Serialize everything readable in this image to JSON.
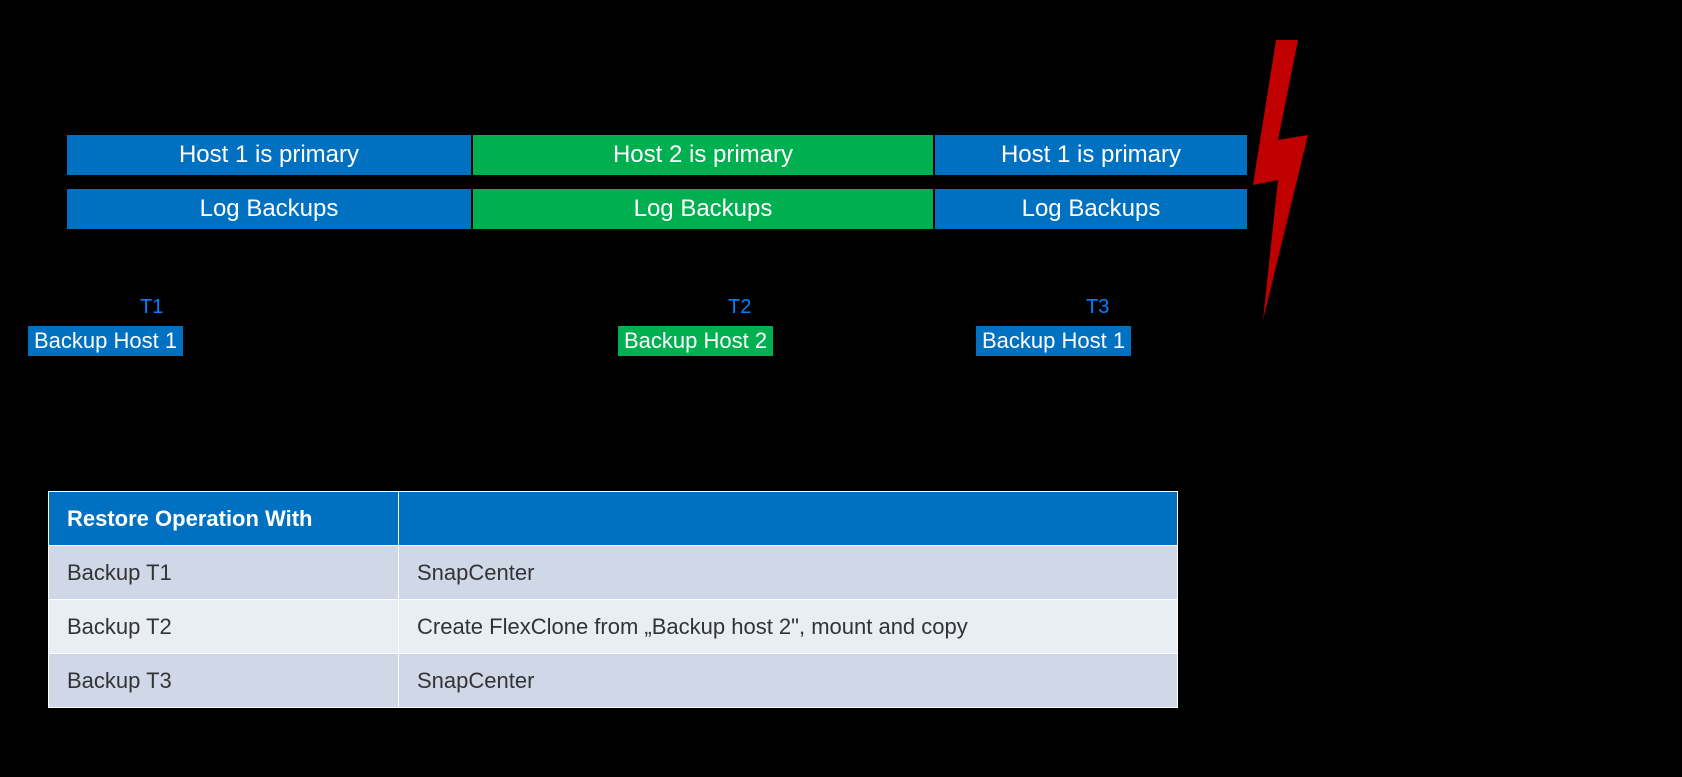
{
  "timeline": {
    "row1": {
      "seg1": "Host 1 is primary",
      "seg2": "Host 2 is primary",
      "seg3": "Host 1 is primary"
    },
    "row2": {
      "seg1": "Log Backups",
      "seg2": "Log Backups",
      "seg3": "Log Backups"
    }
  },
  "markers": {
    "t1": "T1",
    "t2": "T2",
    "t3": "T3"
  },
  "backups": {
    "b1": "Backup Host 1",
    "b2": "Backup Host 2",
    "b3": "Backup Host 1"
  },
  "table": {
    "header1": "Restore Operation With",
    "header2": "",
    "rows": [
      {
        "c1": "Backup T1",
        "c2": "SnapCenter"
      },
      {
        "c1": "Backup T2",
        "c2": "Create FlexClone from „Backup host 2\", mount and copy"
      },
      {
        "c1": "Backup T3",
        "c2": "SnapCenter"
      }
    ]
  }
}
